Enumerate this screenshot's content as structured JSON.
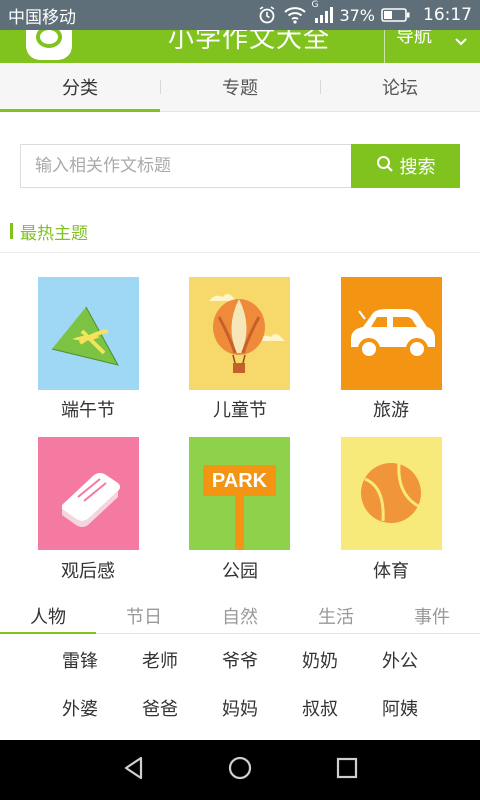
{
  "status_bar": {
    "carrier": "中国移动",
    "network": "G",
    "battery": "37%",
    "time": "16:17"
  },
  "header": {
    "title": "小学作文大全",
    "nav_label": "导航"
  },
  "tabs": [
    "分类",
    "专题",
    "论坛"
  ],
  "active_tab": 0,
  "search": {
    "placeholder": "输入相关作文标题",
    "button": "搜索"
  },
  "section": {
    "title": "最热主题"
  },
  "topics": [
    {
      "label": "端午节",
      "color": "#9fd8f5",
      "icon": "zongzi-icon"
    },
    {
      "label": "儿童节",
      "color": "#f7d96b",
      "icon": "hot-air-balloon-icon"
    },
    {
      "label": "旅游",
      "color": "#f39512",
      "icon": "car-icon"
    },
    {
      "label": "观后感",
      "color": "#f57aa1",
      "icon": "book-icon"
    },
    {
      "label": "公园",
      "color": "#8dd24a",
      "icon": "park-sign-icon"
    },
    {
      "label": "体育",
      "color": "#f7ea7b",
      "icon": "ball-icon"
    }
  ],
  "park_sign_text": "PARK",
  "categories": [
    "人物",
    "节日",
    "自然",
    "生活",
    "事件"
  ],
  "active_category": 0,
  "persons": [
    "雷锋",
    "老师",
    "爷爷",
    "奶奶",
    "外公",
    "外婆",
    "爸爸",
    "妈妈",
    "叔叔",
    "阿姨"
  ],
  "colors": {
    "accent": "#80c31f",
    "status_bar": "#5f6f7a"
  }
}
